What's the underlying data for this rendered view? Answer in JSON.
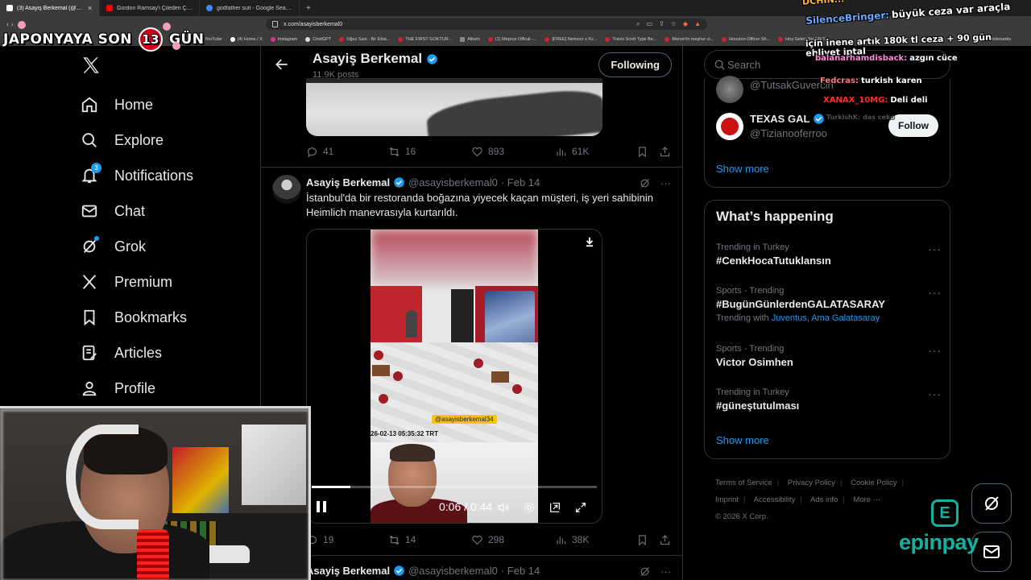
{
  "browser": {
    "tabs": [
      {
        "label": "(3) Asayiş Berkemal (@asayi",
        "active": true,
        "color": "#ffffff"
      },
      {
        "label": "Gordon Ramsay'i Çileden Çıkaran M",
        "active": false,
        "color": "#ff0000"
      },
      {
        "label": "godfather suit - Google Search",
        "active": false,
        "color": "#4285f4"
      }
    ],
    "url": "x.com/asayisberkemal0",
    "bookmarks": [
      "YouTube",
      "(4) Home / X",
      "Instagram",
      "ChatGPT",
      "Oğuz Sasi - Bir Efsa...",
      "THE FIRST GOKTUR...",
      "Albüm",
      "(1) Meproz Offical -...",
      "[FREE] Nemzzz x Ks...",
      "Travis Scott Type Be...",
      "Mersin'in meşhur ci...",
      "Houston Officer Sh...",
      "Hoş Gelen Yer EN T..."
    ],
    "all_bookmarks": "All Bookmarks"
  },
  "overlay": {
    "countdown_prefix": "JAPONYAYA SON",
    "countdown_number": "13",
    "countdown_suffix": "GÜN",
    "chat": [
      {
        "user": "",
        "text": "DCHIN...",
        "color": "#ffb347"
      },
      {
        "user": "SilenceBringer:",
        "text": "büyük ceza var araçla",
        "color": "#6aa9ff"
      },
      {
        "user": "",
        "text": "için inene artık 180k tl ceza + 90 gün ehliyet iptal",
        "color": "#ffffff"
      },
      {
        "user": "balanarhamdisback:",
        "text": "azgın cüce",
        "color": "#ff8ad8"
      },
      {
        "user": "Fedcras:",
        "text": "turkish karen",
        "color": "#ff7a7a"
      },
      {
        "user": "XANAX_10MG:",
        "text": "Deli deli",
        "color": "#ff2b2b"
      },
      {
        "user": "TurkishK:",
        "text": "daş ceko",
        "color": "#888888"
      }
    ],
    "sponsor": "epinpay",
    "sponsor_letter": "E"
  },
  "nav": {
    "items": [
      {
        "label": "Home",
        "icon": "home-icon"
      },
      {
        "label": "Explore",
        "icon": "search-icon"
      },
      {
        "label": "Notifications",
        "icon": "bell-icon",
        "badge": "3"
      },
      {
        "label": "Chat",
        "icon": "mail-icon"
      },
      {
        "label": "Grok",
        "icon": "grok-icon"
      },
      {
        "label": "Premium",
        "icon": "x-icon"
      },
      {
        "label": "Bookmarks",
        "icon": "bookmark-icon"
      },
      {
        "label": "Articles",
        "icon": "article-icon"
      },
      {
        "label": "Profile",
        "icon": "profile-icon"
      }
    ]
  },
  "profile": {
    "name": "Asayiş Berkemal",
    "posts": "11.9K posts",
    "following_label": "Following"
  },
  "tweet_prev": {
    "replies": "41",
    "reposts": "16",
    "likes": "893",
    "views": "61K"
  },
  "tweet": {
    "name": "Asayiş Berkemal",
    "handle": "@asayisberkemal0",
    "date": "· Feb 14",
    "text": "İstanbul'da bir restoranda boğazına yiyecek kaçan müşteri, iş yeri sahibinin Heimlich manevrasıyla kurtarıldı.",
    "video": {
      "watermark": "@asayisberkemal34",
      "cctv_time": "26-02-13 05:35:32 TRT",
      "time": "0:06 / 0:44",
      "progress": 0.136
    },
    "replies": "19",
    "reposts": "14",
    "likes": "298",
    "views": "38K"
  },
  "tweet_next": {
    "name": "Asayiş Berkemal",
    "handle": "@asayisberkemal0",
    "date": "· Feb 14"
  },
  "right": {
    "search_placeholder": "Search",
    "who_to_follow": [
      {
        "name": "",
        "handle": "@TutsakGuvercin"
      },
      {
        "name": "TEXAS GAL",
        "handle": "@Tizianooferroo",
        "button": "Follow"
      }
    ],
    "show_more": "Show more",
    "trends_title": "What’s happening",
    "trends": [
      {
        "context": "Trending in Turkey",
        "title": "#CenkHocaTutuklansın"
      },
      {
        "context": "Sports · Trending",
        "title": "#BugünGünlerdenGALATASARAY",
        "with_prefix": "Trending with",
        "with": "Juventus, Ama Galatasaray"
      },
      {
        "context": "Sports · Trending",
        "title": "Victor Osimhen"
      },
      {
        "context": "Trending in Turkey",
        "title": "#güneştutulması"
      }
    ],
    "trends_show_more": "Show more",
    "footer": [
      "Terms of Service",
      "Privacy Policy",
      "Cookie Policy",
      "Imprint",
      "Accessibility",
      "Ads info",
      "More ···",
      "© 2026 X Corp."
    ]
  },
  "colors": {
    "accent": "#1d9bf0",
    "bg": "#000000",
    "border": "#2f3336",
    "muted": "#71767b",
    "sponsor": "#11b3a0"
  }
}
